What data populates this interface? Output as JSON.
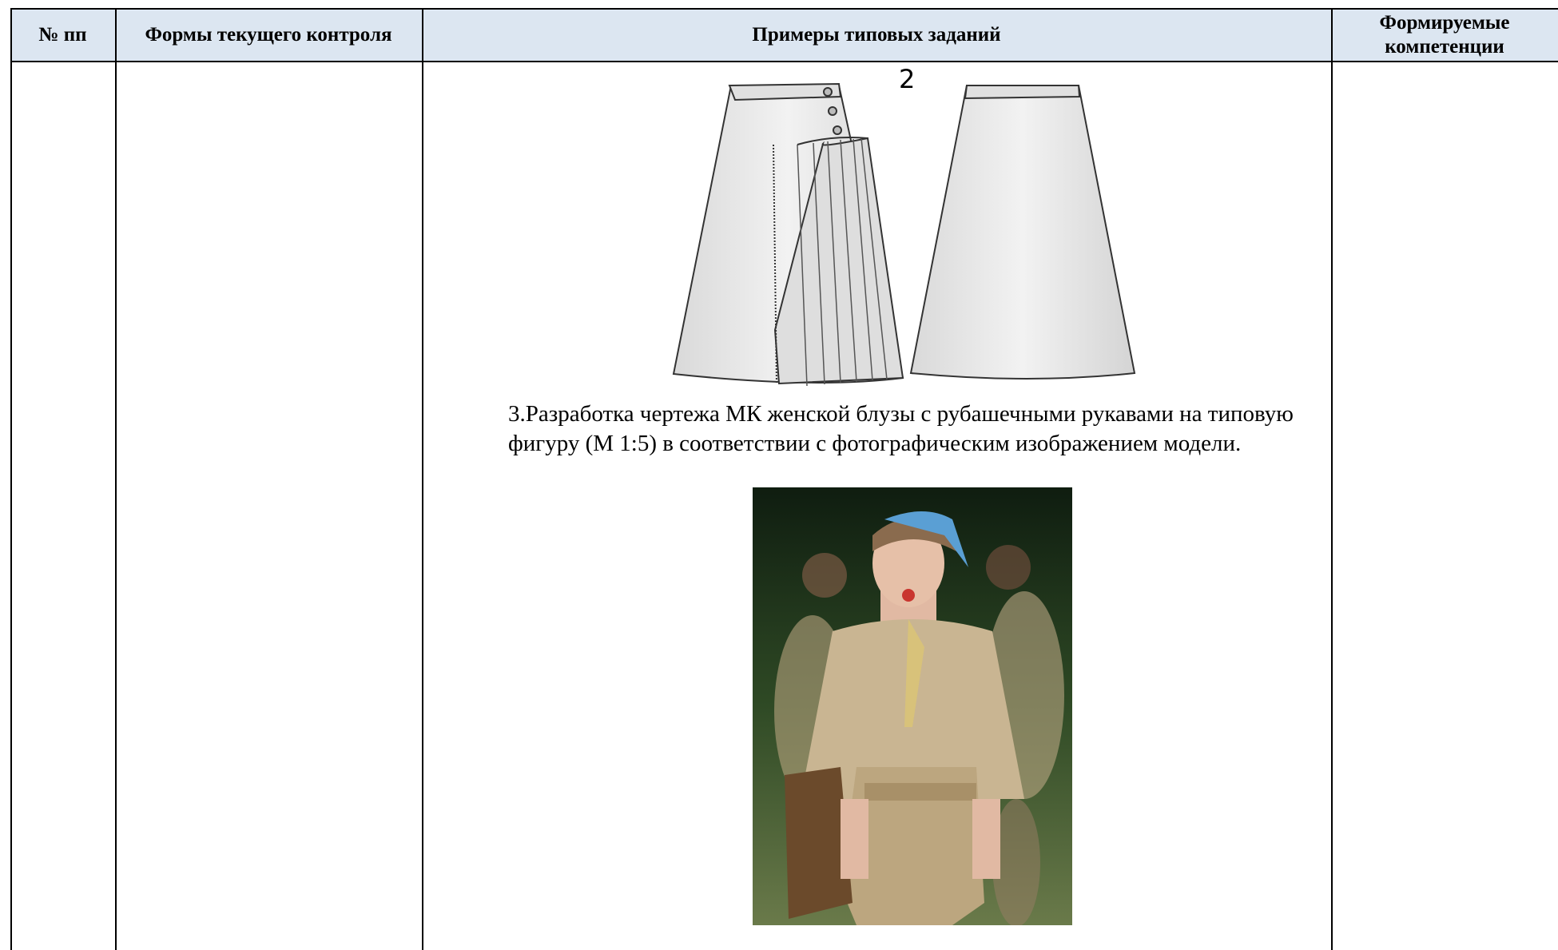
{
  "table": {
    "headers": {
      "num": "№ пп",
      "forms": "Формы текущего контроля",
      "examples": "Примеры типовых заданий",
      "competencies": "Формируемые компетенции"
    }
  },
  "content": {
    "figure_label": "2",
    "task3_text": "3.Разработка чертежа МК женской блузы с рубашечными рукавами на типовую фигуру (М 1:5) в соответствии с фотографическим изображением модели."
  },
  "colors": {
    "header_bg": "#dce6f1",
    "skirt_fill": "#e6e6e6",
    "khaki": "#c9b592",
    "scarf_blue": "#5a9fd4"
  }
}
